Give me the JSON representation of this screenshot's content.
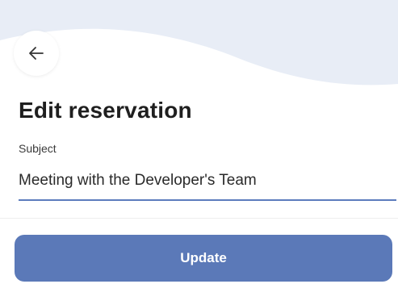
{
  "header": {
    "back_icon": "arrow-left-icon",
    "title": "Edit reservation"
  },
  "form": {
    "subject": {
      "label": "Subject",
      "value": "Meeting with the Developer's Team"
    }
  },
  "actions": {
    "update_label": "Update"
  },
  "colors": {
    "accent": "#5b79b8",
    "wave": "#e8edf6",
    "input_underline": "#5c7cbd"
  }
}
